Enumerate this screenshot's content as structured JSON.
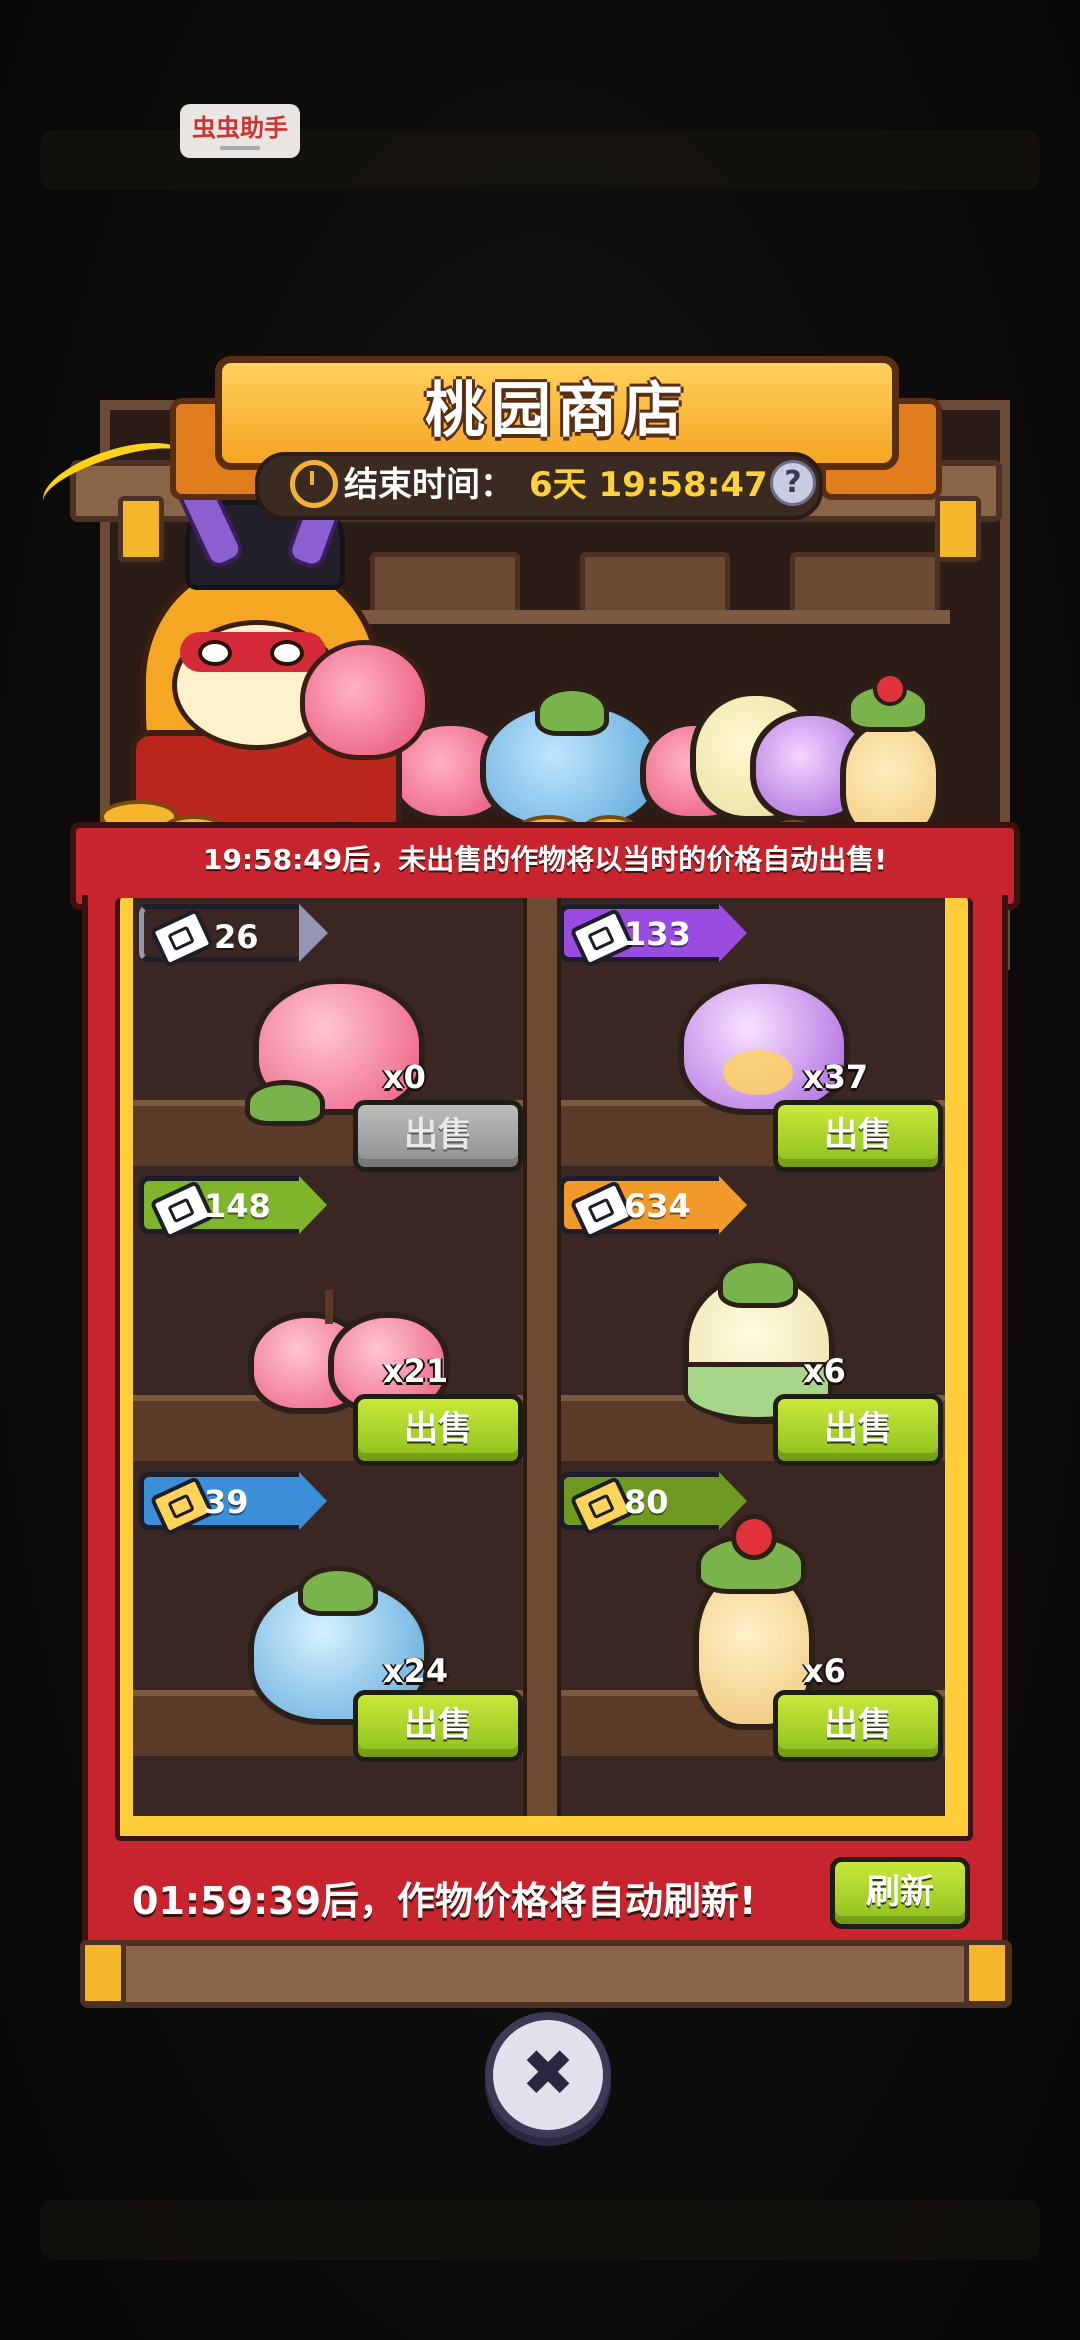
{
  "assistant_tag": "虫虫助手",
  "shop": {
    "title": "桃园商店",
    "end_time_label": "结束时间：",
    "end_time_value": "6天 19:58:47",
    "help_symbol": "?",
    "auto_sell_notice": "19:58:49后，未出售的作物将以当时的价格自动出售!",
    "refresh_notice": "01:59:39后，作物价格将自动刷新!",
    "refresh_label": "刷新",
    "close_symbol": "✖"
  },
  "items": [
    {
      "price": "26",
      "qty": "x0",
      "sell_label": "出售",
      "enabled": false,
      "tag_color": "#9496b3",
      "currency": "silver-ticket-icon",
      "fruit": "pink-peach"
    },
    {
      "price": "133",
      "qty": "x37",
      "sell_label": "出售",
      "enabled": true,
      "tag_color": "#9b4ce0",
      "currency": "silver-ticket-icon",
      "fruit": "purple-peach"
    },
    {
      "price": "148",
      "qty": "x21",
      "sell_label": "出售",
      "enabled": true,
      "tag_color": "#7fb52a",
      "currency": "silver-ticket-icon",
      "fruit": "double-peach"
    },
    {
      "price": "634",
      "qty": "x6",
      "sell_label": "出售",
      "enabled": true,
      "tag_color": "#f19a2a",
      "currency": "silver-ticket-icon",
      "fruit": "cabbage"
    },
    {
      "price": "39",
      "qty": "x24",
      "sell_label": "出售",
      "enabled": true,
      "tag_color": "#3a8fd8",
      "currency": "gold-ticket-icon",
      "fruit": "blue-melon"
    },
    {
      "price": "80",
      "qty": "x6",
      "sell_label": "出售",
      "enabled": true,
      "tag_color": "#6f9a22",
      "currency": "gold-ticket-icon",
      "fruit": "ginseng"
    }
  ],
  "colors": {
    "sell_enabled": "#a6d12a",
    "sell_disabled": "#a8a8a8",
    "frame_red": "#c8242d",
    "gold": "#ffcc3a"
  }
}
